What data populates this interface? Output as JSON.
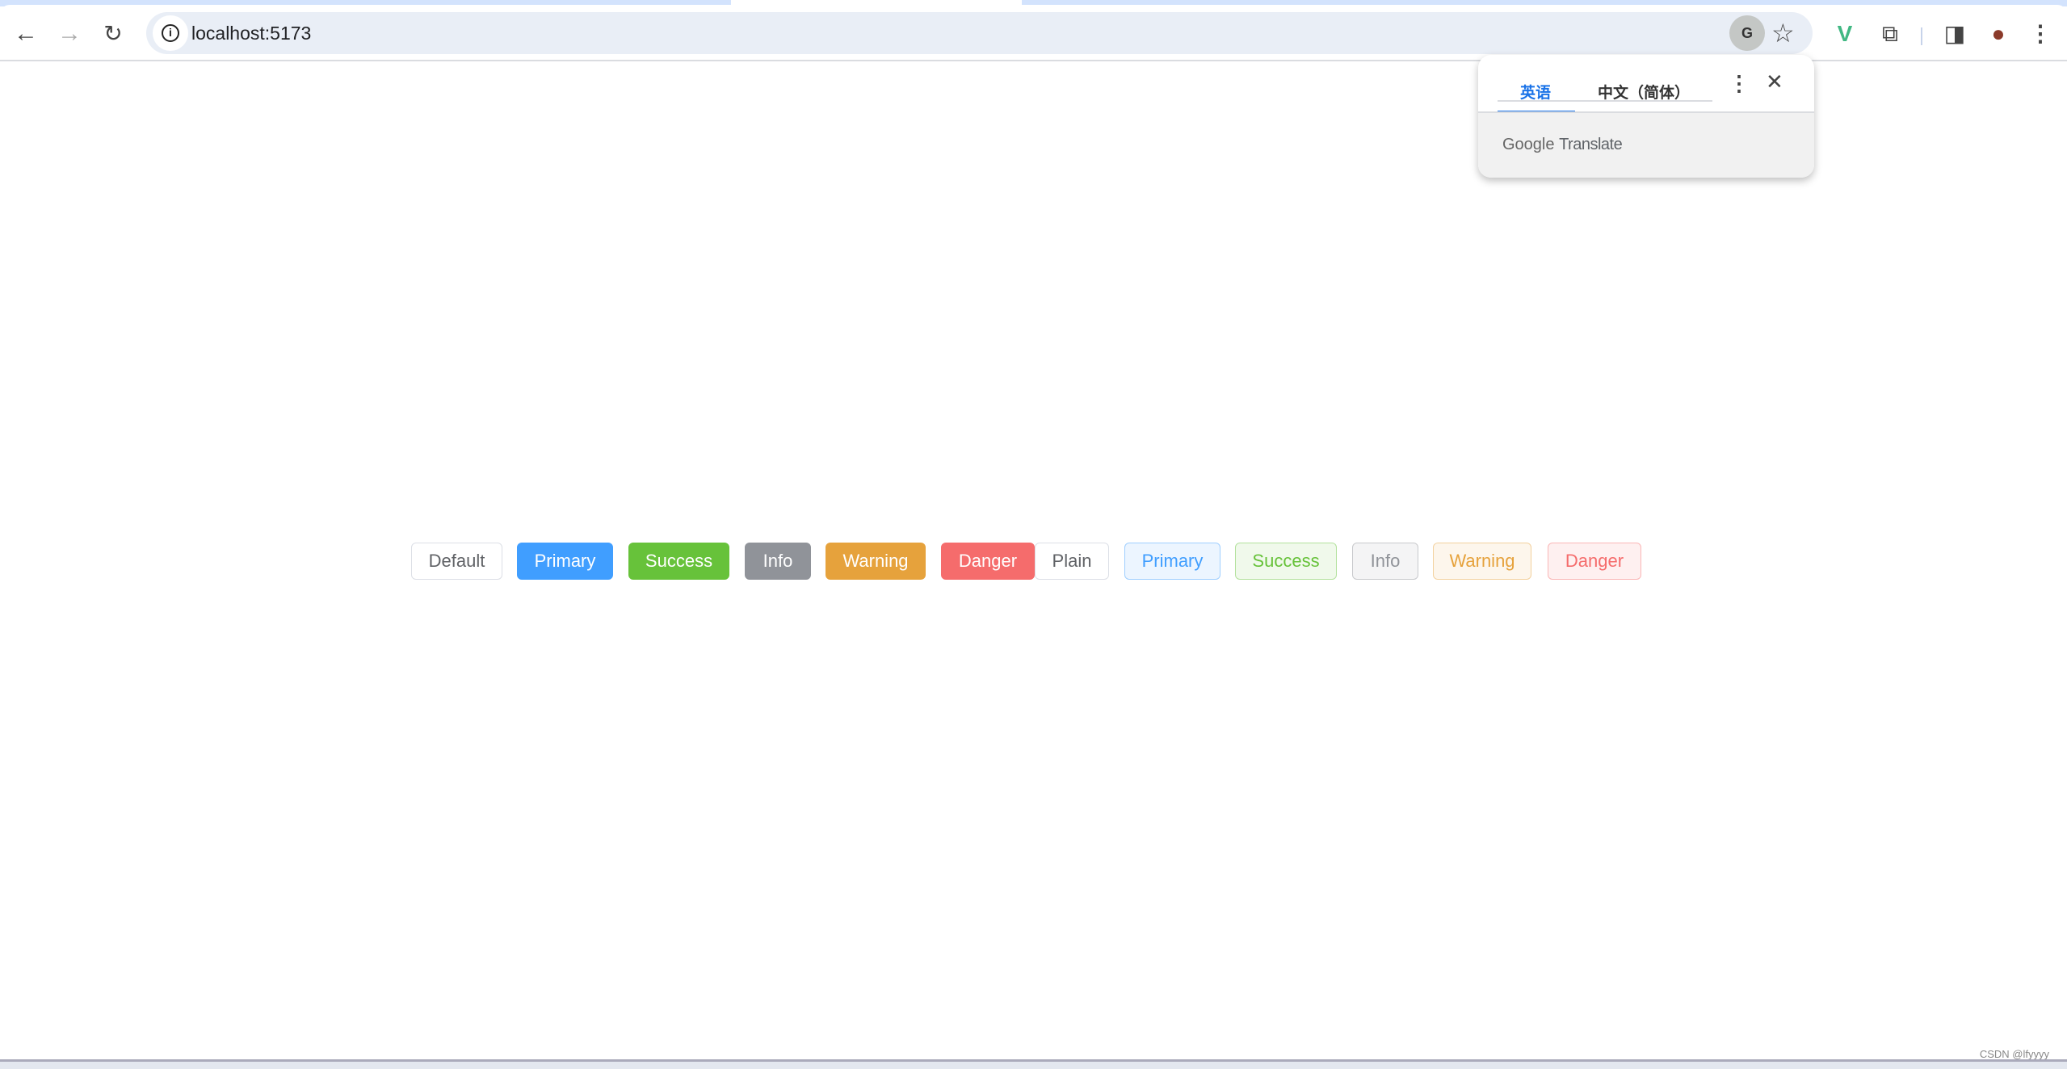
{
  "browser": {
    "url": "localhost:5173",
    "icons": [
      "back-arrow-icon",
      "forward-arrow-icon",
      "reload-icon",
      "site-info-icon",
      "translate-icon",
      "bookmark-star-icon",
      "vue-devtools-icon",
      "extensions-puzzle-icon",
      "side-panel-icon",
      "profile-avatar-icon",
      "menu-kebab-icon"
    ]
  },
  "translate_popup": {
    "tab_source": "英语",
    "tab_target": "中文（简体）",
    "brand_google": "Google",
    "brand_translate": "Translate"
  },
  "buttons": [
    {
      "label": "Default",
      "bg": "#ffffff",
      "fg": "#606266",
      "border": "#dcdfe6"
    },
    {
      "label": "Primary",
      "bg": "#409eff",
      "fg": "#ffffff",
      "border": "#409eff"
    },
    {
      "label": "Success",
      "bg": "#67c23a",
      "fg": "#ffffff",
      "border": "#67c23a"
    },
    {
      "label": "Info",
      "bg": "#909399",
      "fg": "#ffffff",
      "border": "#909399"
    },
    {
      "label": "Warning",
      "bg": "#e6a23c",
      "fg": "#ffffff",
      "border": "#e6a23c"
    },
    {
      "label": "Danger",
      "bg": "#f56c6c",
      "fg": "#ffffff",
      "border": "#f56c6c"
    },
    {
      "label": "Plain",
      "bg": "#ffffff",
      "fg": "#606266",
      "border": "#dcdfe6"
    },
    {
      "label": "Primary",
      "bg": "#ecf5ff",
      "fg": "#409eff",
      "border": "#a0cfff"
    },
    {
      "label": "Success",
      "bg": "#f0f9eb",
      "fg": "#67c23a",
      "border": "#b3e19d"
    },
    {
      "label": "Info",
      "bg": "#f4f4f5",
      "fg": "#909399",
      "border": "#c8c9cc"
    },
    {
      "label": "Warning",
      "bg": "#fdf6ec",
      "fg": "#e6a23c",
      "border": "#f3d19e"
    },
    {
      "label": "Danger",
      "bg": "#fef0f0",
      "fg": "#f56c6c",
      "border": "#fab6b6"
    }
  ],
  "watermark": "CSDN @lfyyyy"
}
